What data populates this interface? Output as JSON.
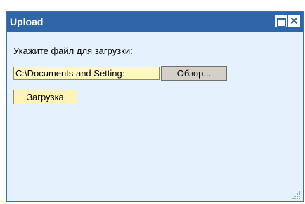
{
  "window": {
    "title": "Upload",
    "maximize_icon": "maximize-icon",
    "close_icon": "close-icon",
    "close_glyph": "✕"
  },
  "form": {
    "prompt_label": "Укажите файл для загрузки:",
    "file_path_value": "C:\\Documents and Setting:",
    "browse_label": "Обзор...",
    "upload_label": "Загрузка"
  },
  "colors": {
    "titlebar": "#2e66a8",
    "panel_background": "#e5f1fd",
    "input_background": "#fff8bd",
    "upload_button_background": "#fff4b8"
  }
}
